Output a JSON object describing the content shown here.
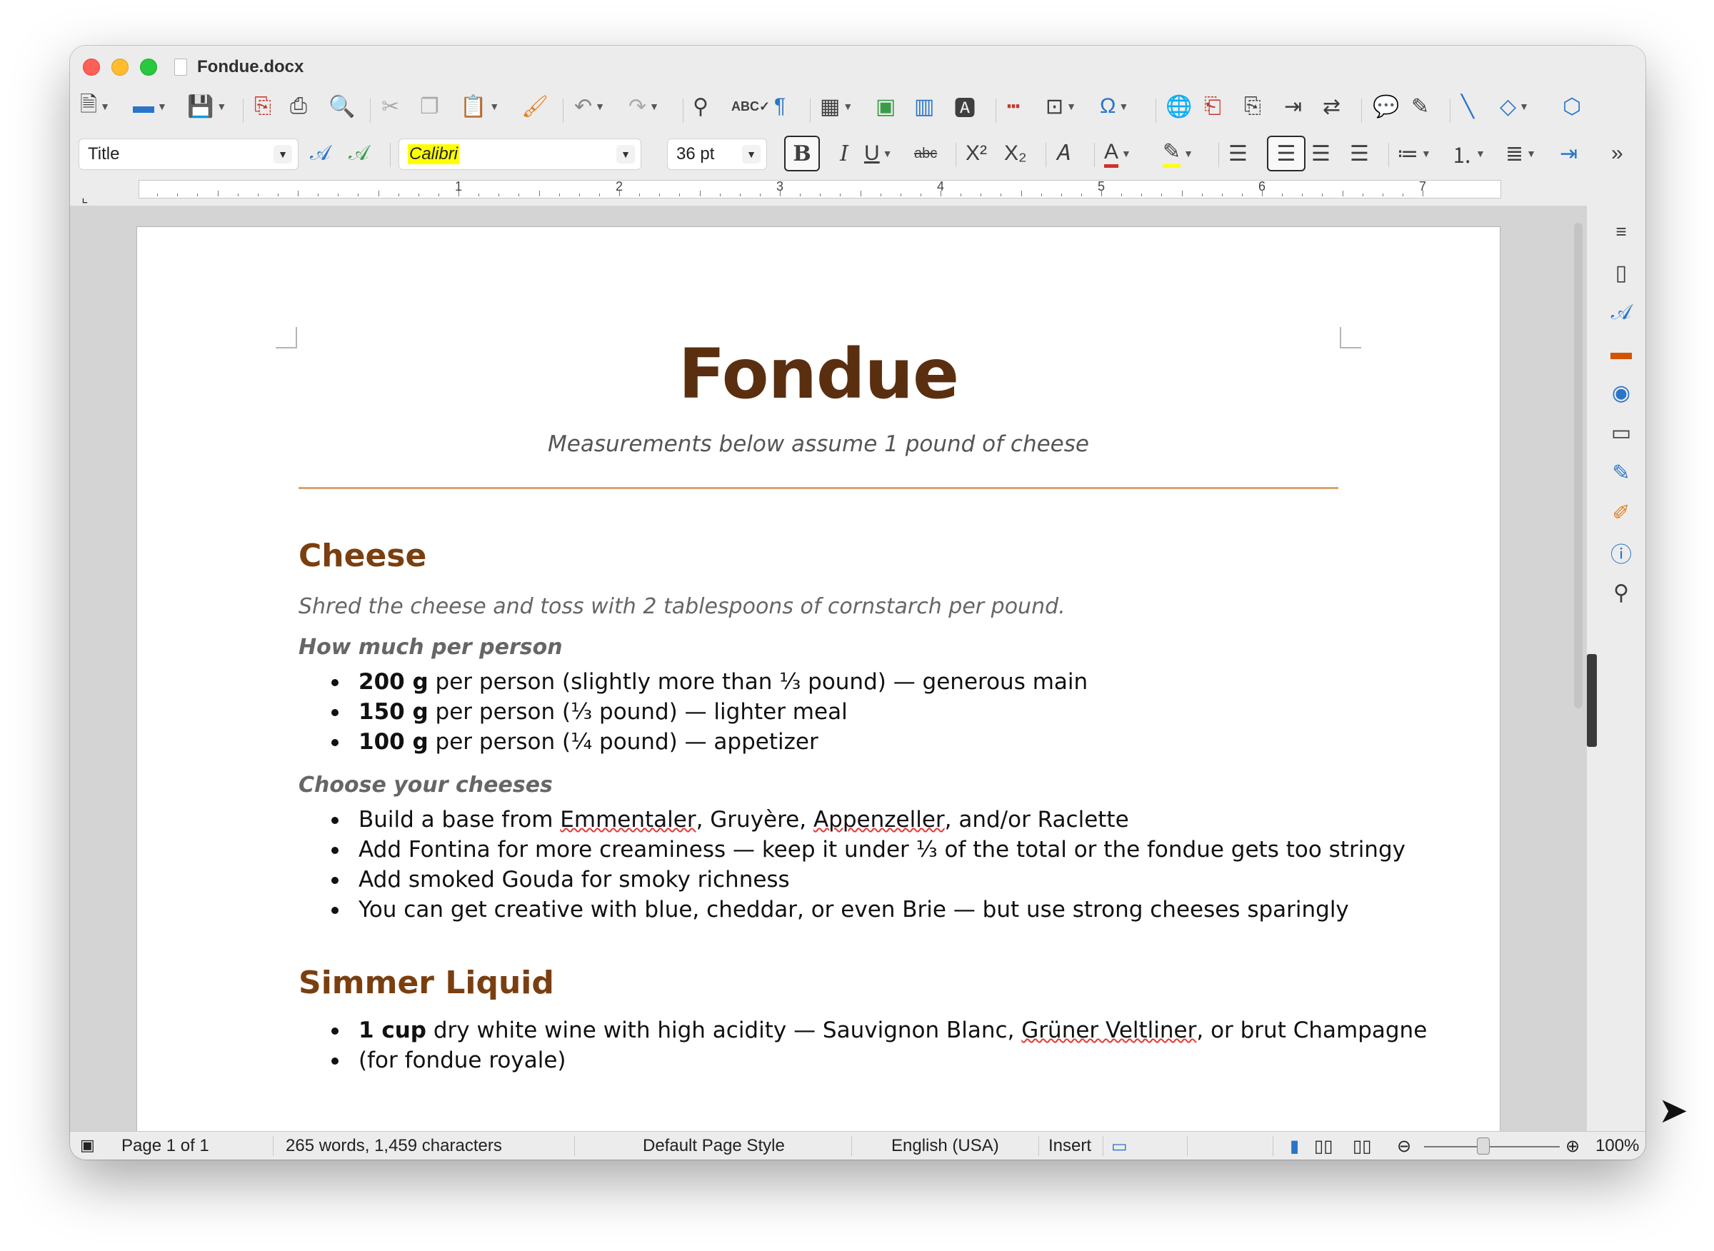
{
  "window": {
    "title": "Fondue.docx"
  },
  "toolbar2": {
    "style_value": "Title",
    "font_value": "Calibri",
    "size_value": "36 pt"
  },
  "ruler": {
    "numbers": [
      "1",
      "2",
      "3",
      "4",
      "5",
      "6",
      "7"
    ]
  },
  "document": {
    "title": "Fondue",
    "subtitle": "Measurements below assume 1 pound of cheese",
    "section1": {
      "heading": "Cheese",
      "intro": "Shred the cheese and toss with 2 tablespoons of cornstarch per pound.",
      "sub1": "How much per person",
      "sub1_items": [
        {
          "bold": "200 g",
          "text": " per person (slightly more than ⅓ pound) — generous main"
        },
        {
          "bold": "150 g",
          "text": " per person (⅓ pound) — lighter meal"
        },
        {
          "bold": "100 g",
          "text": " per person (¼ pound) — appetizer"
        }
      ],
      "sub2": "Choose your cheeses",
      "sub2_item1": {
        "p1": "Build a base from ",
        "w1": "Emmentaler",
        "p2": ", Gruyère, ",
        "w2": "Appenzeller",
        "p3": ", and/or Raclette"
      },
      "sub2_items": [
        "Add Fontina for more creaminess — keep it under ⅓ of the total or the fondue gets too stringy",
        "Add smoked Gouda for smoky richness",
        "You can get creative with blue, cheddar, or even Brie — but use strong cheeses sparingly"
      ]
    },
    "section2": {
      "heading": "Simmer Liquid",
      "item1": {
        "bold": "1 cup",
        "p1": " dry white wine with high acidity — Sauvignon Blanc, ",
        "w1": "Grüner Veltliner",
        "p2": ", or brut Champagne"
      },
      "item1_cont": "(for fondue royale)"
    }
  },
  "status": {
    "page": "Page 1 of 1",
    "words": "265 words, 1,459 characters",
    "page_style": "Default Page Style",
    "language": "English (USA)",
    "mode": "Insert",
    "zoom": "100%",
    "zoom_level_percent": 100
  },
  "colors": {
    "title": "#5a2f10",
    "heading": "#7a3f10",
    "rule": "#d9a46a",
    "highlight": "#ffff00"
  }
}
